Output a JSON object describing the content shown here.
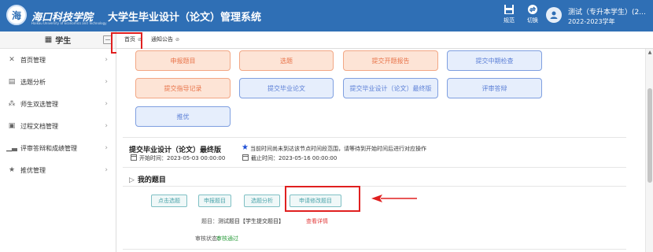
{
  "header": {
    "logo_text": "海",
    "school_name": "海口科技学院",
    "school_sub": "Haikou University of Economics and Technology",
    "system_title": "大学生毕业设计（论文）管理系统",
    "buttons": [
      {
        "label": "规范",
        "icon": "save-icon"
      },
      {
        "label": "切换",
        "icon": "switch-icon"
      }
    ],
    "user_name": "测试（专升本学生）(2...",
    "user_year": "2022-2023学年"
  },
  "sidebar": {
    "title": "学生",
    "items": [
      {
        "label": "首页管理",
        "icon": "tools-icon"
      },
      {
        "label": "选题分析",
        "icon": "chart-icon"
      },
      {
        "label": "师生双选管理",
        "icon": "users-icon"
      },
      {
        "label": "过程文档管理",
        "icon": "document-icon"
      },
      {
        "label": "评审答辩和成绩管理",
        "icon": "bar-chart-icon"
      },
      {
        "label": "推优管理",
        "icon": "star-icon"
      }
    ]
  },
  "tabs": [
    {
      "label": "首页",
      "close": "⊘"
    },
    {
      "label": "通知公告",
      "close": "⊘"
    }
  ],
  "actions": {
    "row1": [
      "申报题目",
      "选题",
      "提交开题报告",
      "提交中期检查"
    ],
    "row2": [
      "提交指导记录",
      "提交毕业论文",
      "提交毕业设计（论文）最终版",
      "评审答辩"
    ],
    "row3": [
      "推优"
    ]
  },
  "notice": {
    "title": "提交毕业设计（论文）最终版",
    "message": "当前时间尚未到达该节点时间段范围，请等待到开始时间后进行对应操作",
    "start": "开始时间：2023-05-03 00:00:00",
    "end": "截止时间：2023-05-16 00:00:00"
  },
  "my_topic": {
    "section_title": "我的题目",
    "buttons": [
      "点击选题",
      "申报题目",
      "选题分析",
      "申请修改题目"
    ],
    "topic_label": "题目：",
    "topic_value": "测试题目【学生提交题目】",
    "detail_link": "查看详情",
    "status_label": "审核状态：",
    "status_value": "审核通过"
  }
}
